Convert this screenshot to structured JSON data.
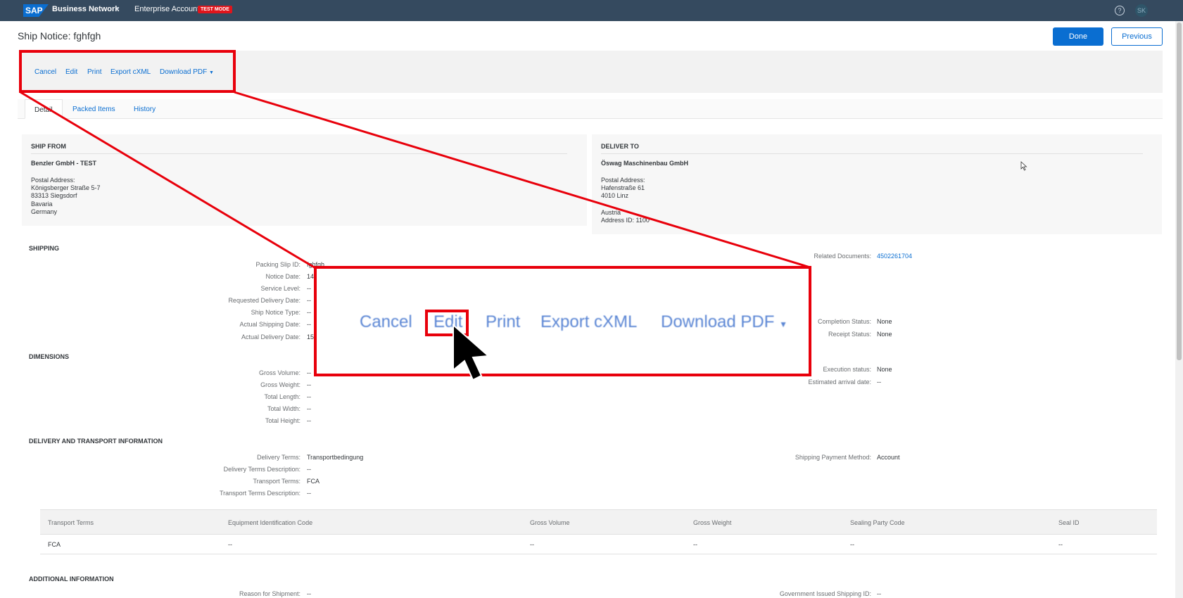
{
  "shell": {
    "logo": "SAP",
    "product": "Business Network",
    "account": "Enterprise Account",
    "test_badge": "TEST MODE",
    "user_initials": "SK",
    "help_icon": "question-circle-icon"
  },
  "header": {
    "title": "Ship Notice: fghfgh",
    "done_label": "Done",
    "previous_label": "Previous"
  },
  "toolbar": {
    "cancel": "Cancel",
    "edit": "Edit",
    "print": "Print",
    "export": "Export cXML",
    "download": "Download PDF"
  },
  "tabs": {
    "detail": "Detail",
    "packed_items": "Packed Items",
    "history": "History"
  },
  "ship_from": {
    "heading": "SHIP FROM",
    "name": "Benzler GmbH - TEST",
    "lines": [
      "Postal Address:",
      "Königsberger Straße 5-7",
      "83313 Siegsdorf",
      "Bavaria",
      "Germany"
    ]
  },
  "deliver_to": {
    "heading": "DELIVER TO",
    "name": "Öswag Maschinenbau GmbH",
    "lines": [
      "Postal Address:",
      "Hafenstraße 61",
      "4010 Linz",
      "",
      "Austria",
      "Address ID: 1100"
    ]
  },
  "shipping": {
    "heading": "SHIPPING",
    "packing_slip_label": "Packing Slip ID:",
    "packing_slip_value": "fghfgh",
    "notice_date_label": "Notice Date:",
    "notice_date_value": "14",
    "service_level_label": "Service Level:",
    "service_level_value": "--",
    "requested_delivery_label": "Requested Delivery Date:",
    "requested_delivery_value": "--",
    "ship_notice_type_label": "Ship Notice Type:",
    "ship_notice_type_value": "--",
    "actual_shipping_label": "Actual Shipping Date:",
    "actual_shipping_value": "--",
    "actual_delivery_label": "Actual Delivery Date:",
    "actual_delivery_value": "15",
    "related_docs_label": "Related Documents:",
    "related_docs_value": "4502261704",
    "completion_label": "Completion Status:",
    "completion_value": "None",
    "receipt_label": "Receipt Status:",
    "receipt_value": "None"
  },
  "dimensions": {
    "heading": "DIMENSIONS",
    "gross_volume_label": "Gross Volume:",
    "gross_volume_value": "--",
    "gross_weight_label": "Gross Weight:",
    "gross_weight_value": "--",
    "total_length_label": "Total Length:",
    "total_length_value": "--",
    "total_width_label": "Total Width:",
    "total_width_value": "--",
    "total_height_label": "Total Height:",
    "total_height_value": "--",
    "execution_label": "Execution status:",
    "execution_value": "None",
    "arrival_label": "Estimated arrival date:",
    "arrival_value": "--"
  },
  "delivery": {
    "heading": "DELIVERY AND TRANSPORT INFORMATION",
    "terms_label": "Delivery Terms:",
    "terms_value": "Transportbedingung",
    "terms_desc_label": "Delivery Terms Description:",
    "terms_desc_value": "--",
    "transport_label": "Transport Terms:",
    "transport_value": "FCA",
    "transport_desc_label": "Transport Terms Description:",
    "transport_desc_value": "--",
    "payment_label": "Shipping Payment Method:",
    "payment_value": "Account"
  },
  "transport_table": {
    "headers": [
      "Transport Terms",
      "Equipment Identification Code",
      "Gross Volume",
      "Gross Weight",
      "Sealing Party Code",
      "Seal ID"
    ],
    "row": [
      "FCA",
      "--",
      "--",
      "--",
      "--",
      "--"
    ]
  },
  "additional": {
    "heading": "ADDITIONAL INFORMATION",
    "reason_label": "Reason for Shipment:",
    "reason_value": "--",
    "gov_label": "Government Issued Shipping ID:",
    "gov_value": "--"
  },
  "callout": {
    "cancel": "Cancel",
    "edit": "Edit",
    "print": "Print",
    "export": "Export cXML",
    "download": "Download PDF",
    "highlight_color": "#e8000b",
    "cursor_icon": "arrow-cursor-icon"
  },
  "colors": {
    "shell": "#354a5f",
    "link": "#0a6ed1",
    "test_badge": "#e0151c"
  }
}
